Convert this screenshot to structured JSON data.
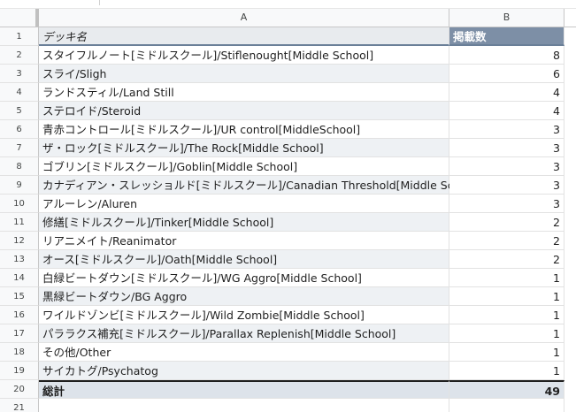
{
  "sheet": {
    "columns": [
      "A",
      "B"
    ],
    "header": {
      "name": "デッキ名",
      "count": "掲載数"
    },
    "rows": [
      {
        "name": "スタイフルノート[ミドルスクール]/Stiflenought[Middle School]",
        "count": "8"
      },
      {
        "name": "スライ/Sligh",
        "count": "6"
      },
      {
        "name": "ランドスティル/Land Still",
        "count": "4"
      },
      {
        "name": "ステロイド/Steroid",
        "count": "4"
      },
      {
        "name": "青赤コントロール[ミドルスクール]/UR control[MiddleSchool]",
        "count": "3"
      },
      {
        "name": "ザ・ロック[ミドルスクール]/The Rock[Middle School]",
        "count": "3"
      },
      {
        "name": "ゴブリン[ミドルスクール]/Goblin[Middle School]",
        "count": "3"
      },
      {
        "name": "カナディアン・スレッショルド[ミドルスクール]/Canadian Threshold[Middle School]",
        "count": "3"
      },
      {
        "name": "アルーレン/Aluren",
        "count": "3"
      },
      {
        "name": "修繕[ミドルスクール]/Tinker[Middle School]",
        "count": "2"
      },
      {
        "name": "リアニメイト/Reanimator",
        "count": "2"
      },
      {
        "name": "オース[ミドルスクール]/Oath[Middle School]",
        "count": "2"
      },
      {
        "name": "白緑ビートダウン[ミドルスクール]/WG Aggro[Middle School]",
        "count": "1"
      },
      {
        "name": "黒緑ビートダウン/BG Aggro",
        "count": "1"
      },
      {
        "name": "ワイルドゾンビ[ミドルスクール]/Wild Zombie[Middle School]",
        "count": "1"
      },
      {
        "name": "パララクス補充[ミドルスクール]/Parallax Replenish[Middle School]",
        "count": "1"
      },
      {
        "name": "その他/Other",
        "count": "1"
      },
      {
        "name": "サイカトグ/Psychatog",
        "count": "1"
      }
    ],
    "total": {
      "label": "総計",
      "count": "49"
    },
    "row_numbers": [
      "1",
      "2",
      "3",
      "4",
      "5",
      "6",
      "7",
      "8",
      "9",
      "10",
      "11",
      "12",
      "13",
      "14",
      "15",
      "16",
      "17",
      "18",
      "19",
      "20",
      "21"
    ]
  }
}
